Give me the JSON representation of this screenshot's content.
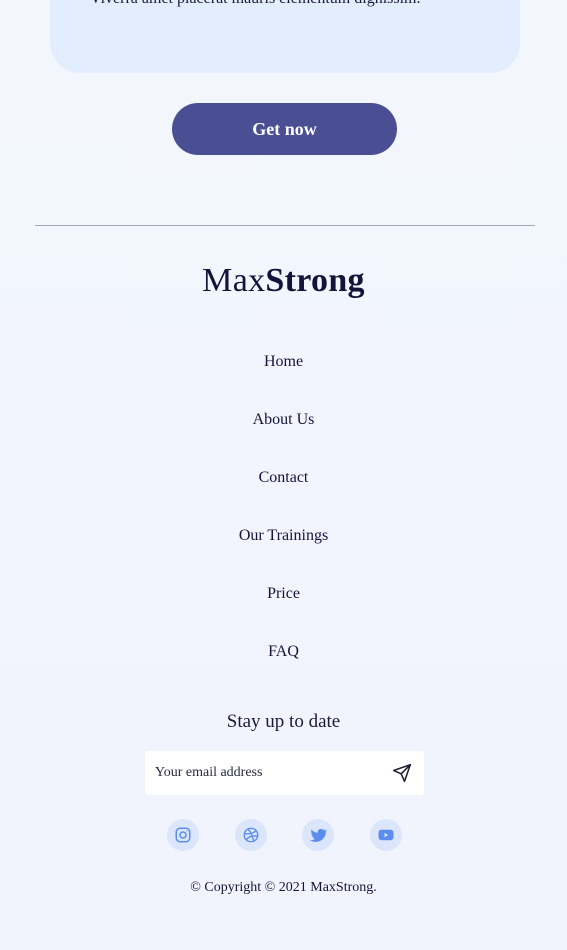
{
  "card": {
    "text": "Viverra amet placerat mauris elementum dignissim."
  },
  "cta": {
    "label": "Get now"
  },
  "footer": {
    "logo": {
      "light": "Max",
      "bold": "Strong"
    },
    "nav": [
      "Home",
      "About Us",
      "Contact",
      "Our Trainings",
      "Price",
      "FAQ"
    ],
    "newsletter": {
      "title": "Stay up to date",
      "placeholder": "Your email address",
      "send_icon": "paper-plane-icon"
    },
    "social": [
      {
        "name": "instagram-icon"
      },
      {
        "name": "dribbble-icon"
      },
      {
        "name": "twitter-icon"
      },
      {
        "name": "youtube-icon"
      }
    ],
    "copyright": "© Copyright © 2021 MaxStrong."
  },
  "colors": {
    "accent": "#4a4f93",
    "icon": "#5b8def",
    "icon_bg": "#dbe6fb",
    "card_bg": "#e2eefe"
  }
}
